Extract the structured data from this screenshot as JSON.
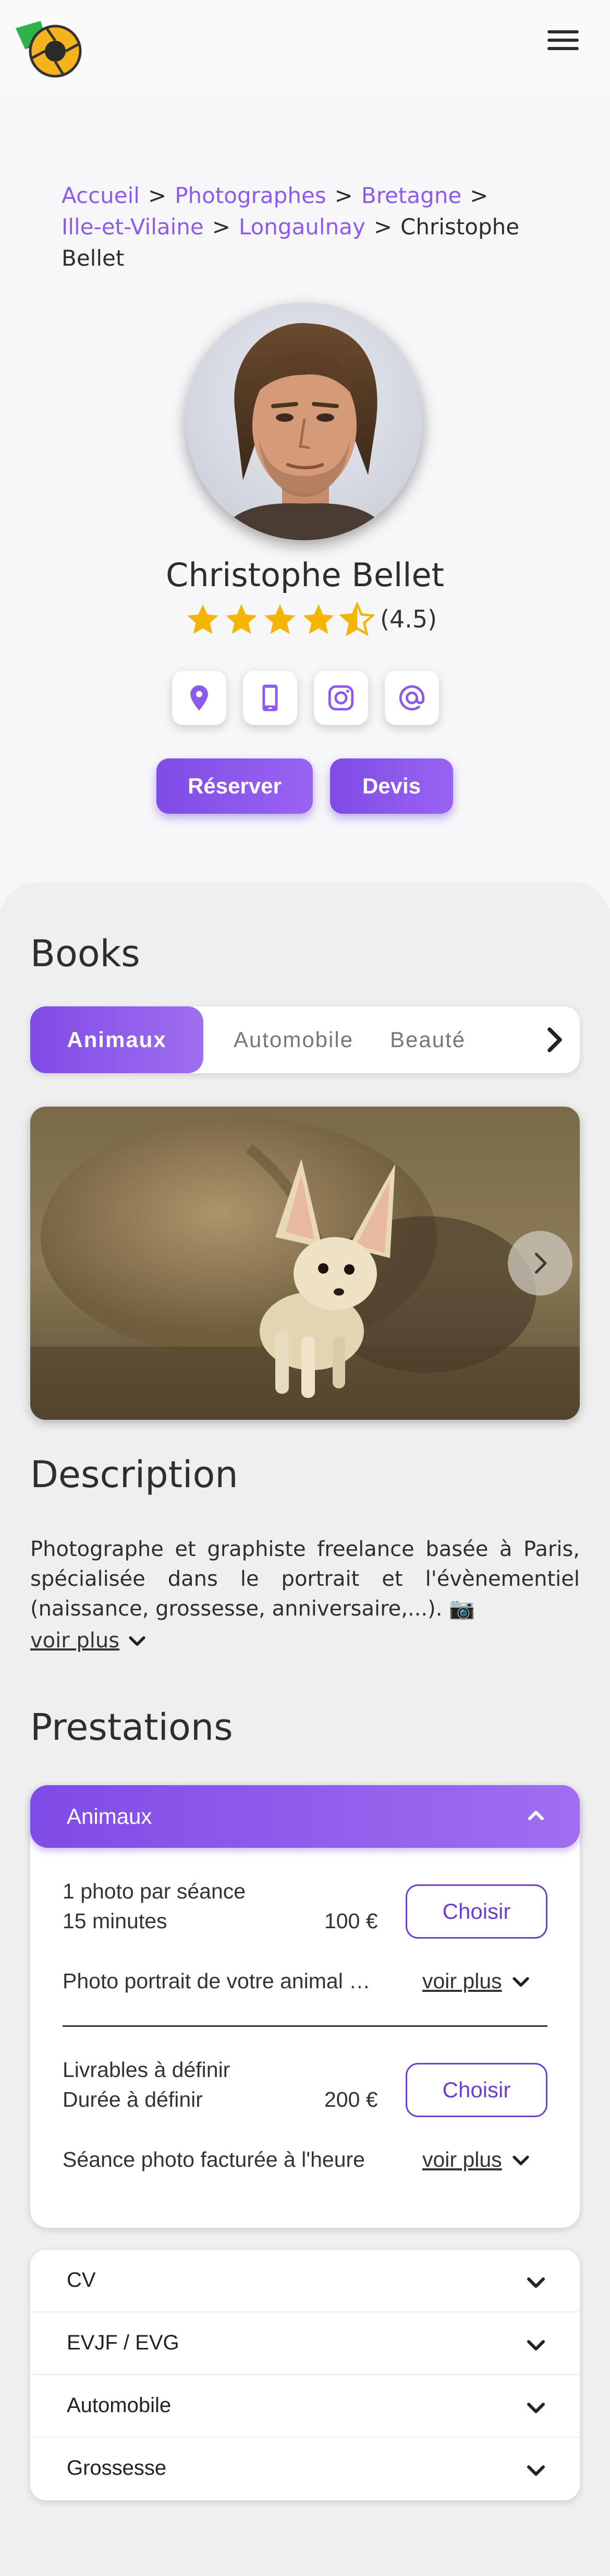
{
  "header": {
    "logo_icon": "camera-shutter-logo",
    "menu_icon": "hamburger-menu-icon"
  },
  "breadcrumb": {
    "items": [
      "Accueil",
      "Photographes",
      "Bretagne",
      "Ille-et-Vilaine",
      "Longaulnay"
    ],
    "current": "Christophe Bellet",
    "separator": ">"
  },
  "profile": {
    "name": "Christophe Bellet",
    "rating_value": 4.5,
    "rating_text": "(4.5)",
    "contact_icons": [
      "location-pin-icon",
      "mobile-phone-icon",
      "instagram-icon",
      "email-at-icon"
    ],
    "reserve_label": "Réserver",
    "quote_label": "Devis"
  },
  "books": {
    "title": "Books",
    "tabs": [
      "Animaux",
      "Automobile",
      "Beauté"
    ],
    "active_tab": "Animaux"
  },
  "description": {
    "title": "Description",
    "text": "Photographe et graphiste freelance basée à Paris, spécialisée dans le portrait et l'évènementiel (naissance, grossesse, anniversaire,...). 📷",
    "more_label": "voir plus"
  },
  "prestations": {
    "title": "Prestations",
    "open_category": "Animaux",
    "services": [
      {
        "line1": "1 photo par séance",
        "line2": "15 minutes",
        "price": "100 €",
        "choose_label": "Choisir",
        "desc": "Photo portrait de votre animal de compagnie",
        "more_label": "voir plus"
      },
      {
        "line1": "Livrables à définir",
        "line2": "Durée à définir",
        "price": "200 €",
        "choose_label": "Choisir",
        "desc": "Séance photo facturée à l'heure",
        "more_label": "voir plus"
      }
    ],
    "other_categories": [
      "CV",
      "EVJF / EVG",
      "Automobile",
      "Grossesse"
    ]
  },
  "colors": {
    "accent": "#8d5be9",
    "accent_dark": "#6c3fcf",
    "star": "#f5b400"
  }
}
